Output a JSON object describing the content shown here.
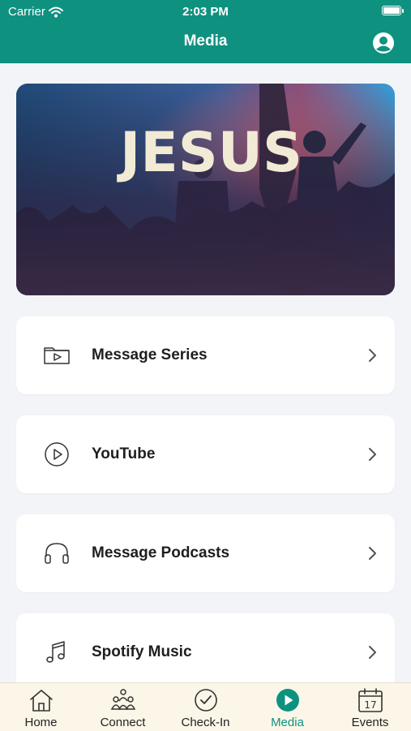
{
  "status_bar": {
    "carrier": "Carrier",
    "time": "2:03 PM"
  },
  "header": {
    "title": "Media",
    "profile_icon": "person-circle-icon"
  },
  "hero": {
    "text": "JESUS"
  },
  "menu": {
    "items": [
      {
        "label": "Message Series",
        "icon": "folder-play-icon"
      },
      {
        "label": "YouTube",
        "icon": "play-circle-icon"
      },
      {
        "label": "Message Podcasts",
        "icon": "headphones-icon"
      },
      {
        "label": "Spotify Music",
        "icon": "music-note-icon"
      }
    ]
  },
  "tabbar": {
    "tabs": [
      {
        "label": "Home",
        "icon": "home-icon"
      },
      {
        "label": "Connect",
        "icon": "people-icon"
      },
      {
        "label": "Check-In",
        "icon": "check-circle-icon"
      },
      {
        "label": "Media",
        "icon": "play-circle-filled-icon"
      },
      {
        "label": "Events",
        "icon": "calendar-icon",
        "calendar_day": "17"
      }
    ],
    "active": "Media"
  },
  "colors": {
    "brand": "#0f9180",
    "tabbar_bg": "#fbf6e8",
    "page_bg": "#f3f4f7"
  }
}
